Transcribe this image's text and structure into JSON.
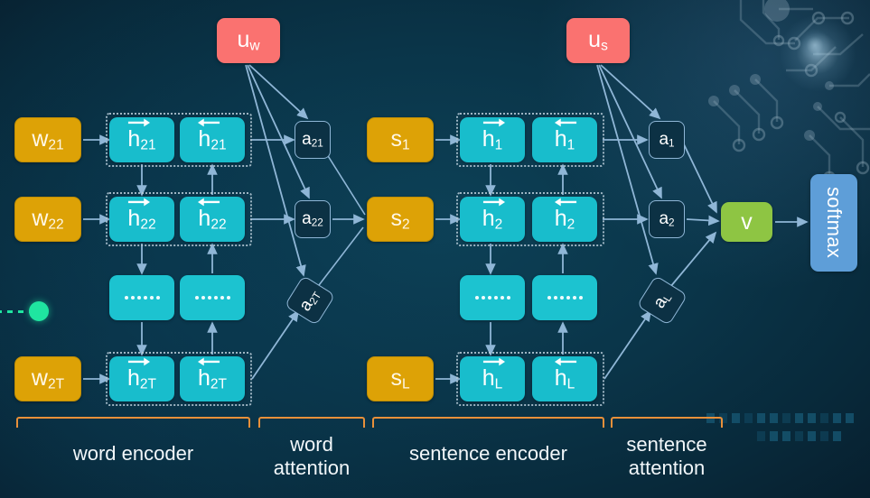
{
  "title": "Hierarchical Attention Network architecture",
  "colors": {
    "background": "#0a3549",
    "word_box": "#dda206",
    "hidden_box": "#18bdcc",
    "attention_box_border": "#8fb6d6",
    "context_vector": "#fa7270",
    "doc_vector": "#8ec543",
    "softmax": "#5e9ed8",
    "bracket": "#e8903a",
    "edge": "#8fb6d6",
    "green_dot": "#1fe5a0"
  },
  "word_encoder": {
    "inputs": [
      {
        "label": "w",
        "sub": "21"
      },
      {
        "label": "w",
        "sub": "22"
      },
      {
        "label": "w",
        "sub": "2T"
      }
    ],
    "hidden_forward": [
      {
        "label": "h",
        "sub": "21",
        "direction": "forward"
      },
      {
        "label": "h",
        "sub": "22",
        "direction": "forward"
      },
      {
        "label": "",
        "sub": "",
        "direction": "dots"
      },
      {
        "label": "h",
        "sub": "2T",
        "direction": "forward"
      }
    ],
    "hidden_backward": [
      {
        "label": "h",
        "sub": "21",
        "direction": "backward"
      },
      {
        "label": "h",
        "sub": "22",
        "direction": "backward"
      },
      {
        "label": "",
        "sub": "",
        "direction": "dots"
      },
      {
        "label": "h",
        "sub": "2T",
        "direction": "backward"
      }
    ]
  },
  "word_attention": {
    "context_vector": {
      "label": "u",
      "sub": "w"
    },
    "weights": [
      {
        "label": "a",
        "sub": "21"
      },
      {
        "label": "a",
        "sub": "22"
      },
      {
        "label": "a",
        "sub": "2T"
      }
    ]
  },
  "sentence_encoder": {
    "inputs": [
      {
        "label": "s",
        "sub": "1"
      },
      {
        "label": "s",
        "sub": "2"
      },
      {
        "label": "s",
        "sub": "L"
      }
    ],
    "hidden_forward": [
      {
        "label": "h",
        "sub": "1",
        "direction": "forward"
      },
      {
        "label": "h",
        "sub": "2",
        "direction": "forward"
      },
      {
        "label": "",
        "sub": "",
        "direction": "dots"
      },
      {
        "label": "h",
        "sub": "L",
        "direction": "forward"
      }
    ],
    "hidden_backward": [
      {
        "label": "h",
        "sub": "1",
        "direction": "backward"
      },
      {
        "label": "h",
        "sub": "2",
        "direction": "backward"
      },
      {
        "label": "",
        "sub": "",
        "direction": "dots"
      },
      {
        "label": "h",
        "sub": "L",
        "direction": "backward"
      }
    ]
  },
  "sentence_attention": {
    "context_vector": {
      "label": "u",
      "sub": "s"
    },
    "weights": [
      {
        "label": "a",
        "sub": "1"
      },
      {
        "label": "a",
        "sub": "2"
      },
      {
        "label": "a",
        "sub": "L"
      }
    ]
  },
  "output": {
    "document_vector": "v",
    "classifier": "softmax"
  },
  "captions": [
    {
      "id": "word-encoder",
      "line1": "word encoder",
      "line2": ""
    },
    {
      "id": "word-attention",
      "line1": "word",
      "line2": "attention"
    },
    {
      "id": "sentence-encoder",
      "line1": "sentence encoder",
      "line2": ""
    },
    {
      "id": "sentence-attention",
      "line1": "sentence",
      "line2": "attention"
    }
  ]
}
